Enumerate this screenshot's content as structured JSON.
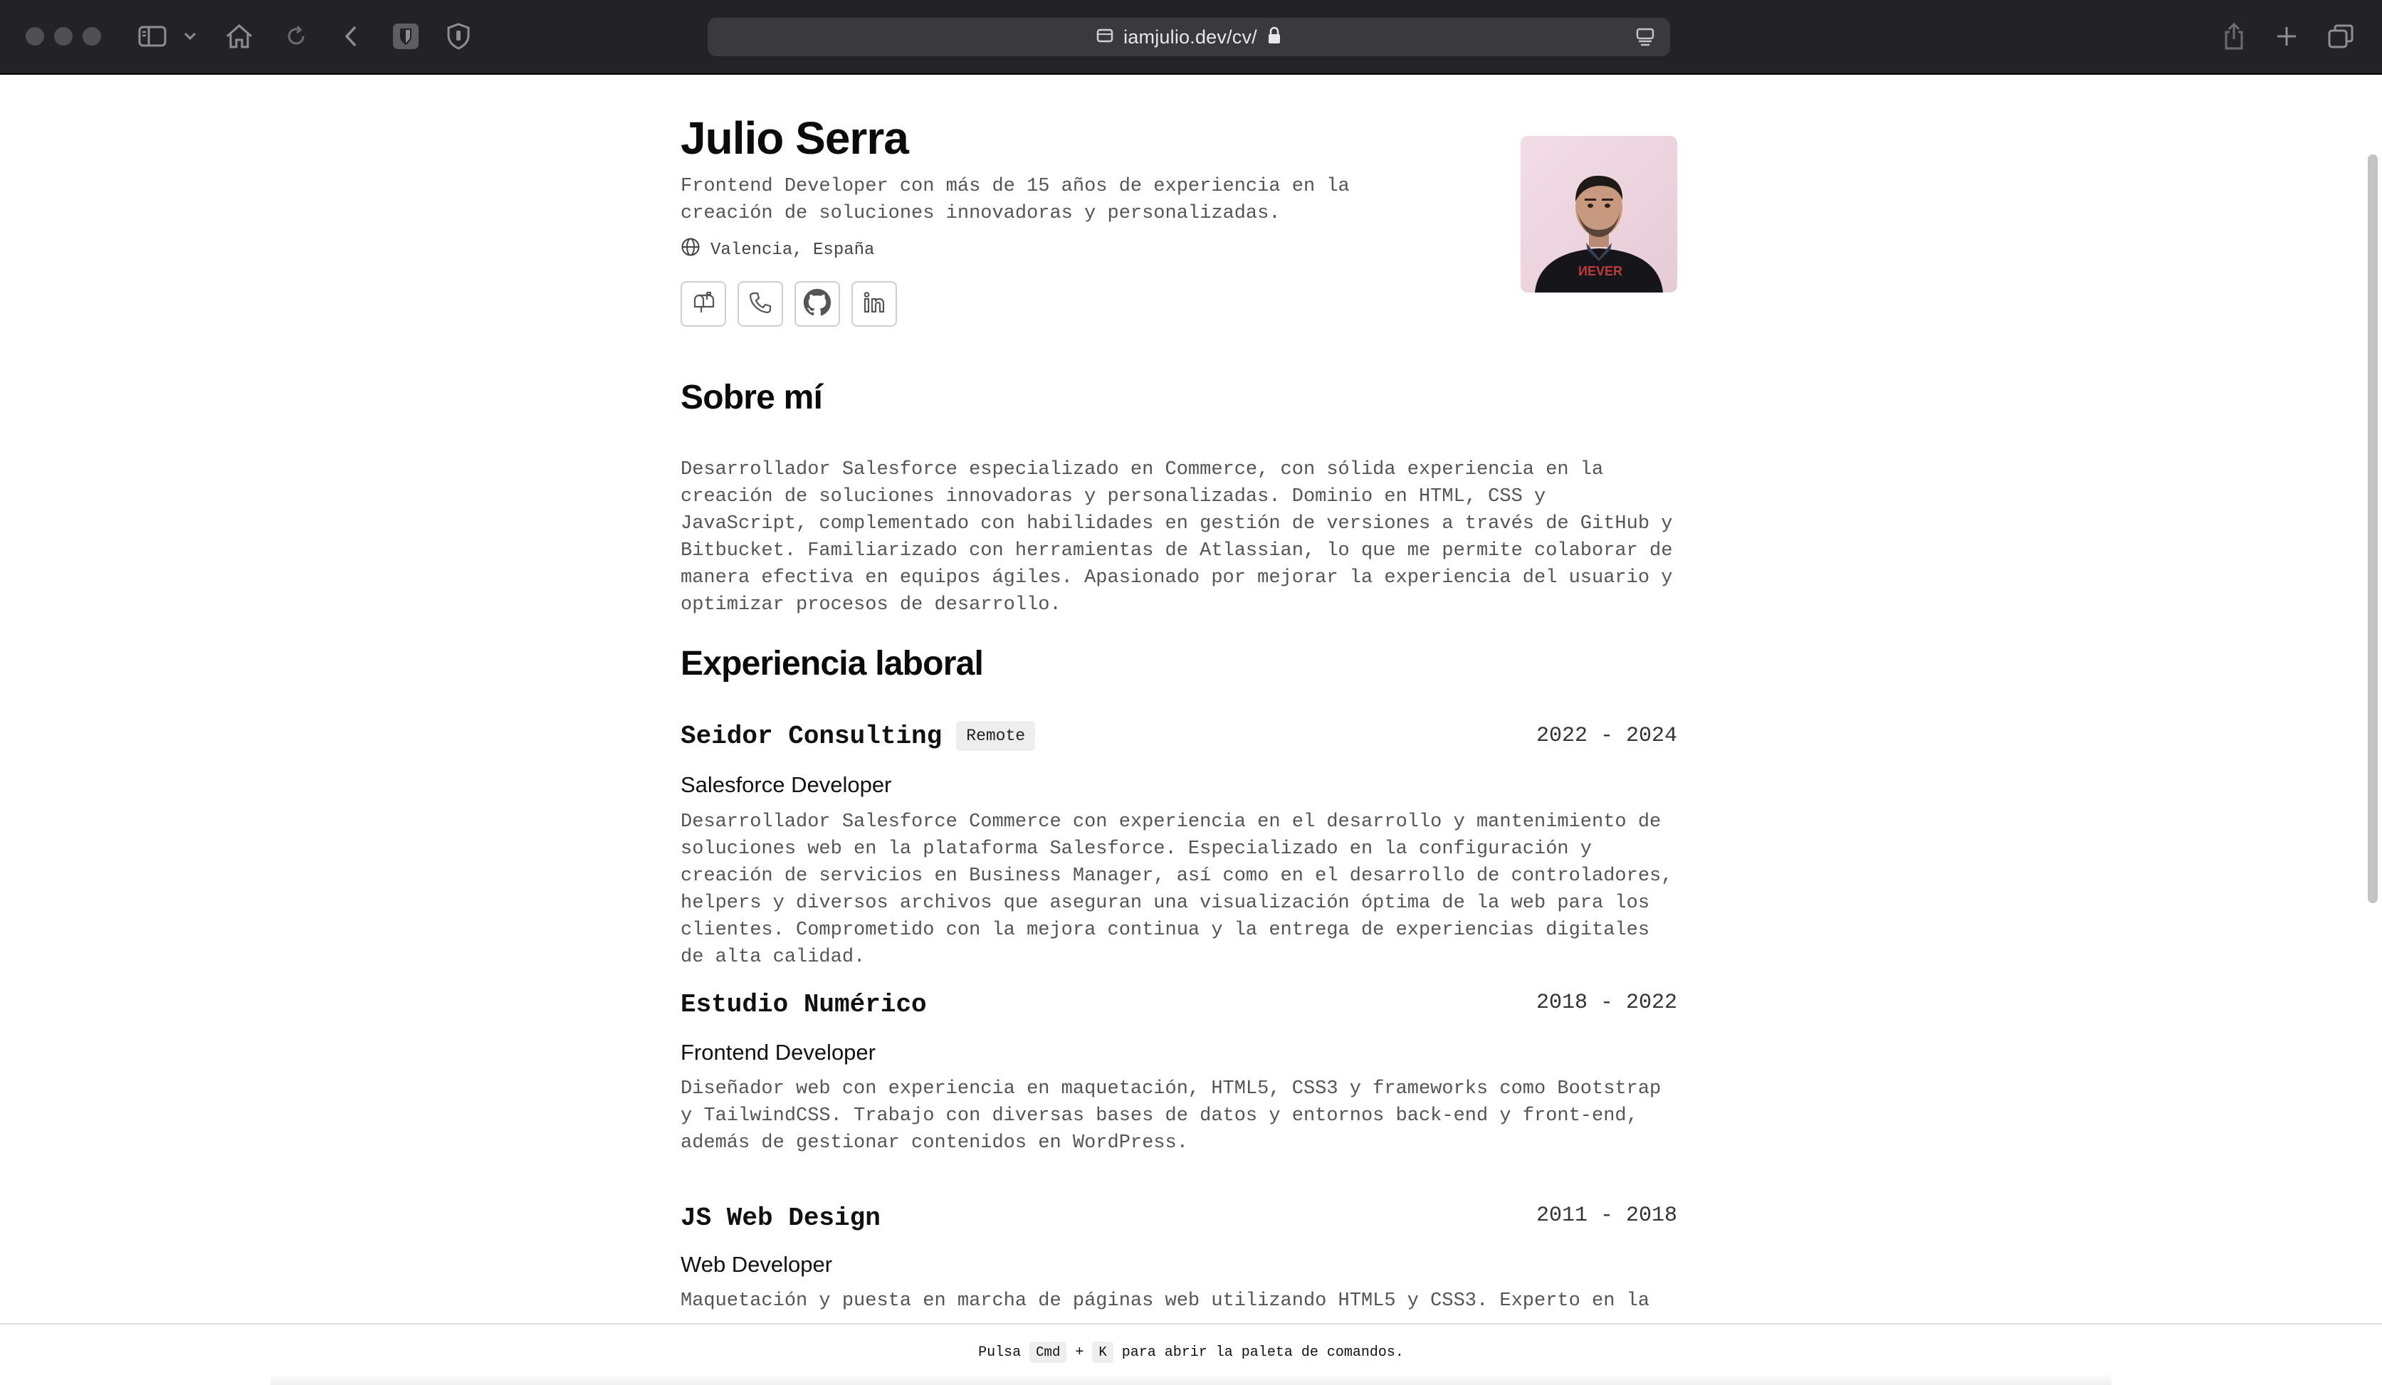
{
  "browser": {
    "url": "iamjulio.dev/cv/",
    "icons": [
      "sidebar-icon",
      "chevron-down-icon",
      "home-icon",
      "reload-icon",
      "back-icon",
      "bitwarden-icon",
      "shield-icon",
      "site-icon",
      "lock-icon",
      "reader-icon",
      "share-icon",
      "plus-icon",
      "tabs-icon"
    ]
  },
  "header": {
    "name": "Julio Serra",
    "tagline": "Frontend Developer con más de 15 años de experiencia en la creación de soluciones innovadoras y personalizadas.",
    "location": "Valencia, España",
    "socials": [
      "mail-icon",
      "phone-icon",
      "github-icon",
      "linkedin-icon"
    ]
  },
  "about": {
    "title": "Sobre mí",
    "text": "Desarrollador Salesforce especializado en Commerce, con sólida experiencia en la creación de soluciones innovadoras y personalizadas. Dominio en HTML, CSS y JavaScript, complementado con habilidades en gestión de versiones a través de GitHub y Bitbucket. Familiarizado con herramientas de Atlassian, lo que me permite colaborar de manera efectiva en equipos ágiles. Apasionado por mejorar la experiencia del usuario y optimizar procesos de desarrollo."
  },
  "experience": {
    "title": "Experiencia laboral",
    "jobs": [
      {
        "company": "Seidor Consulting",
        "badge": "Remote",
        "years": "2022 - 2024",
        "role": "Salesforce Developer",
        "description": "Desarrollador Salesforce Commerce con experiencia en el desarrollo y mantenimiento de soluciones web en la plataforma Salesforce. Especializado en la configuración y creación de servicios en Business Manager, así como en el desarrollo de controladores, helpers y diversos archivos que aseguran una visualización óptima de la web para los clientes. Comprometido con la mejora continua y la entrega de experiencias digitales de alta calidad."
      },
      {
        "company": "Estudio Numérico",
        "years": "2018 - 2022",
        "role": "Frontend Developer",
        "description": "Diseñador web con experiencia en maquetación, HTML5, CSS3 y frameworks como Bootstrap y TailwindCSS. Trabajo con diversas bases de datos y entornos back-end y front-end, además de gestionar contenidos en WordPress."
      },
      {
        "company": "JS Web Design",
        "years": "2011 - 2018",
        "role": "Web Developer",
        "description": "Maquetación y puesta en marcha de páginas web utilizando HTML5 y CSS3. Experto en la"
      }
    ]
  },
  "command_bar": {
    "prefix": "Pulsa",
    "key1": "Cmd",
    "plus": "+",
    "key2": "K",
    "suffix": "para abrir la paleta de comandos."
  }
}
